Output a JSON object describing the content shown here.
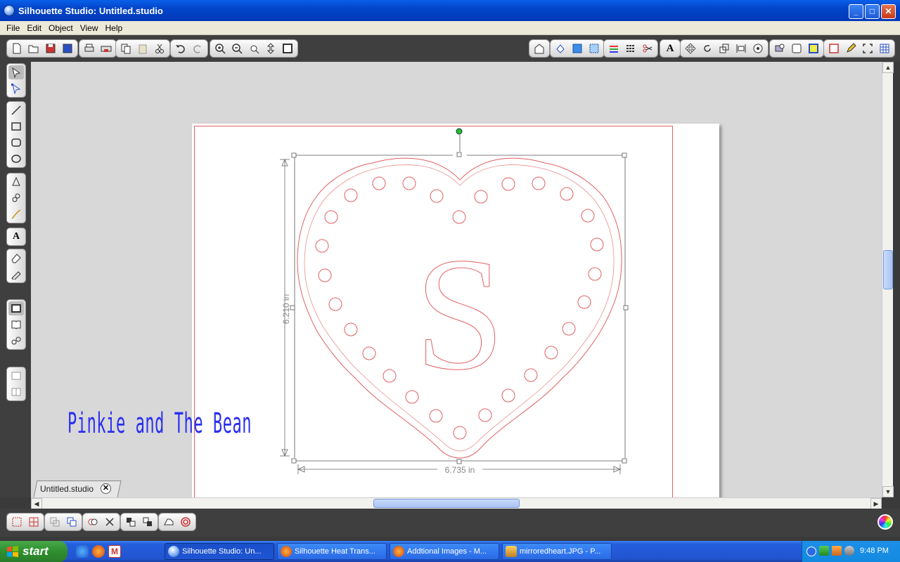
{
  "window": {
    "title": "Silhouette Studio: Untitled.studio",
    "controls": [
      "minimize",
      "maximize",
      "close"
    ]
  },
  "menu": {
    "items": [
      "File",
      "Edit",
      "Object",
      "View",
      "Help"
    ]
  },
  "toolbar": {
    "groups": [
      [
        "new-document-icon",
        "open-icon",
        "save-icon",
        "save-to-library-icon"
      ],
      [
        "print-icon",
        "send-to-silhouette-icon"
      ],
      [
        "copy-icon",
        "paste-icon",
        "cut-icon"
      ],
      [
        "undo-icon",
        "redo-icon"
      ],
      [
        "zoom-in-icon",
        "zoom-out-icon",
        "zoom-select-icon",
        "pan-icon",
        "fit-to-page-icon"
      ],
      [
        "library-icon"
      ],
      [
        "fill-color-icon",
        "fill-pattern-icon",
        "gradient-icon"
      ],
      [
        "line-color-icon",
        "line-style-icon",
        "cut-style-icon"
      ],
      [
        "text-style-icon"
      ],
      [
        "transform-icon",
        "rotate-icon",
        "scale-icon",
        "align-icon",
        "replicate-icon"
      ],
      [
        "trace-icon",
        "offset-icon",
        "layers-icon"
      ],
      [
        "page-setup-icon",
        "sketch-icon",
        "registration-marks-icon",
        "grid-icon"
      ]
    ]
  },
  "left_tools": {
    "groups": [
      [
        "select-tool-icon",
        "edit-points-icon"
      ],
      [
        "line-tool-icon",
        "rectangle-tool-icon",
        "rounded-rectangle-tool-icon",
        "ellipse-tool-icon"
      ],
      [
        "polygon-tool-icon",
        "curve-tool-icon",
        "freehand-tool-icon"
      ],
      [
        "text-tool-icon"
      ],
      [
        "eraser-tool-icon",
        "knife-tool-icon"
      ],
      [
        "page-view-icon",
        "library-view-icon",
        "link-view-icon"
      ],
      [
        "panel-top-icon",
        "panel-bottom-icon"
      ]
    ]
  },
  "document": {
    "tab_label": "Untitled.studio",
    "width_label": "6.735 in",
    "height_label": "6.210 in",
    "letter": "S",
    "watermark": "Pinkie and The Bean"
  },
  "bottom_tools": {
    "groups": [
      [
        "group-icon",
        "ungroup-icon"
      ],
      [
        "make-compound-path-icon",
        "release-compound-path-icon"
      ],
      [
        "weld-icon",
        "delete-icon"
      ],
      [
        "bring-forward-icon",
        "send-backward-icon"
      ],
      [
        "modify-icon",
        "offset-circle-icon"
      ]
    ]
  },
  "taskbar": {
    "start_label": "start",
    "items": [
      {
        "label": "Silhouette Studio: Un...",
        "active": true
      },
      {
        "label": "Silhouette Heat Trans...",
        "active": false
      },
      {
        "label": "Addtional Images - M...",
        "active": false
      },
      {
        "label": "mirroredheart.JPG - P...",
        "active": false
      }
    ],
    "clock": "9:48 PM"
  },
  "colors": {
    "cut_line": "#e06060",
    "watermark": "#2a2ff0",
    "titlebar": "#0245c9",
    "rotate_handle": "#22c022"
  }
}
